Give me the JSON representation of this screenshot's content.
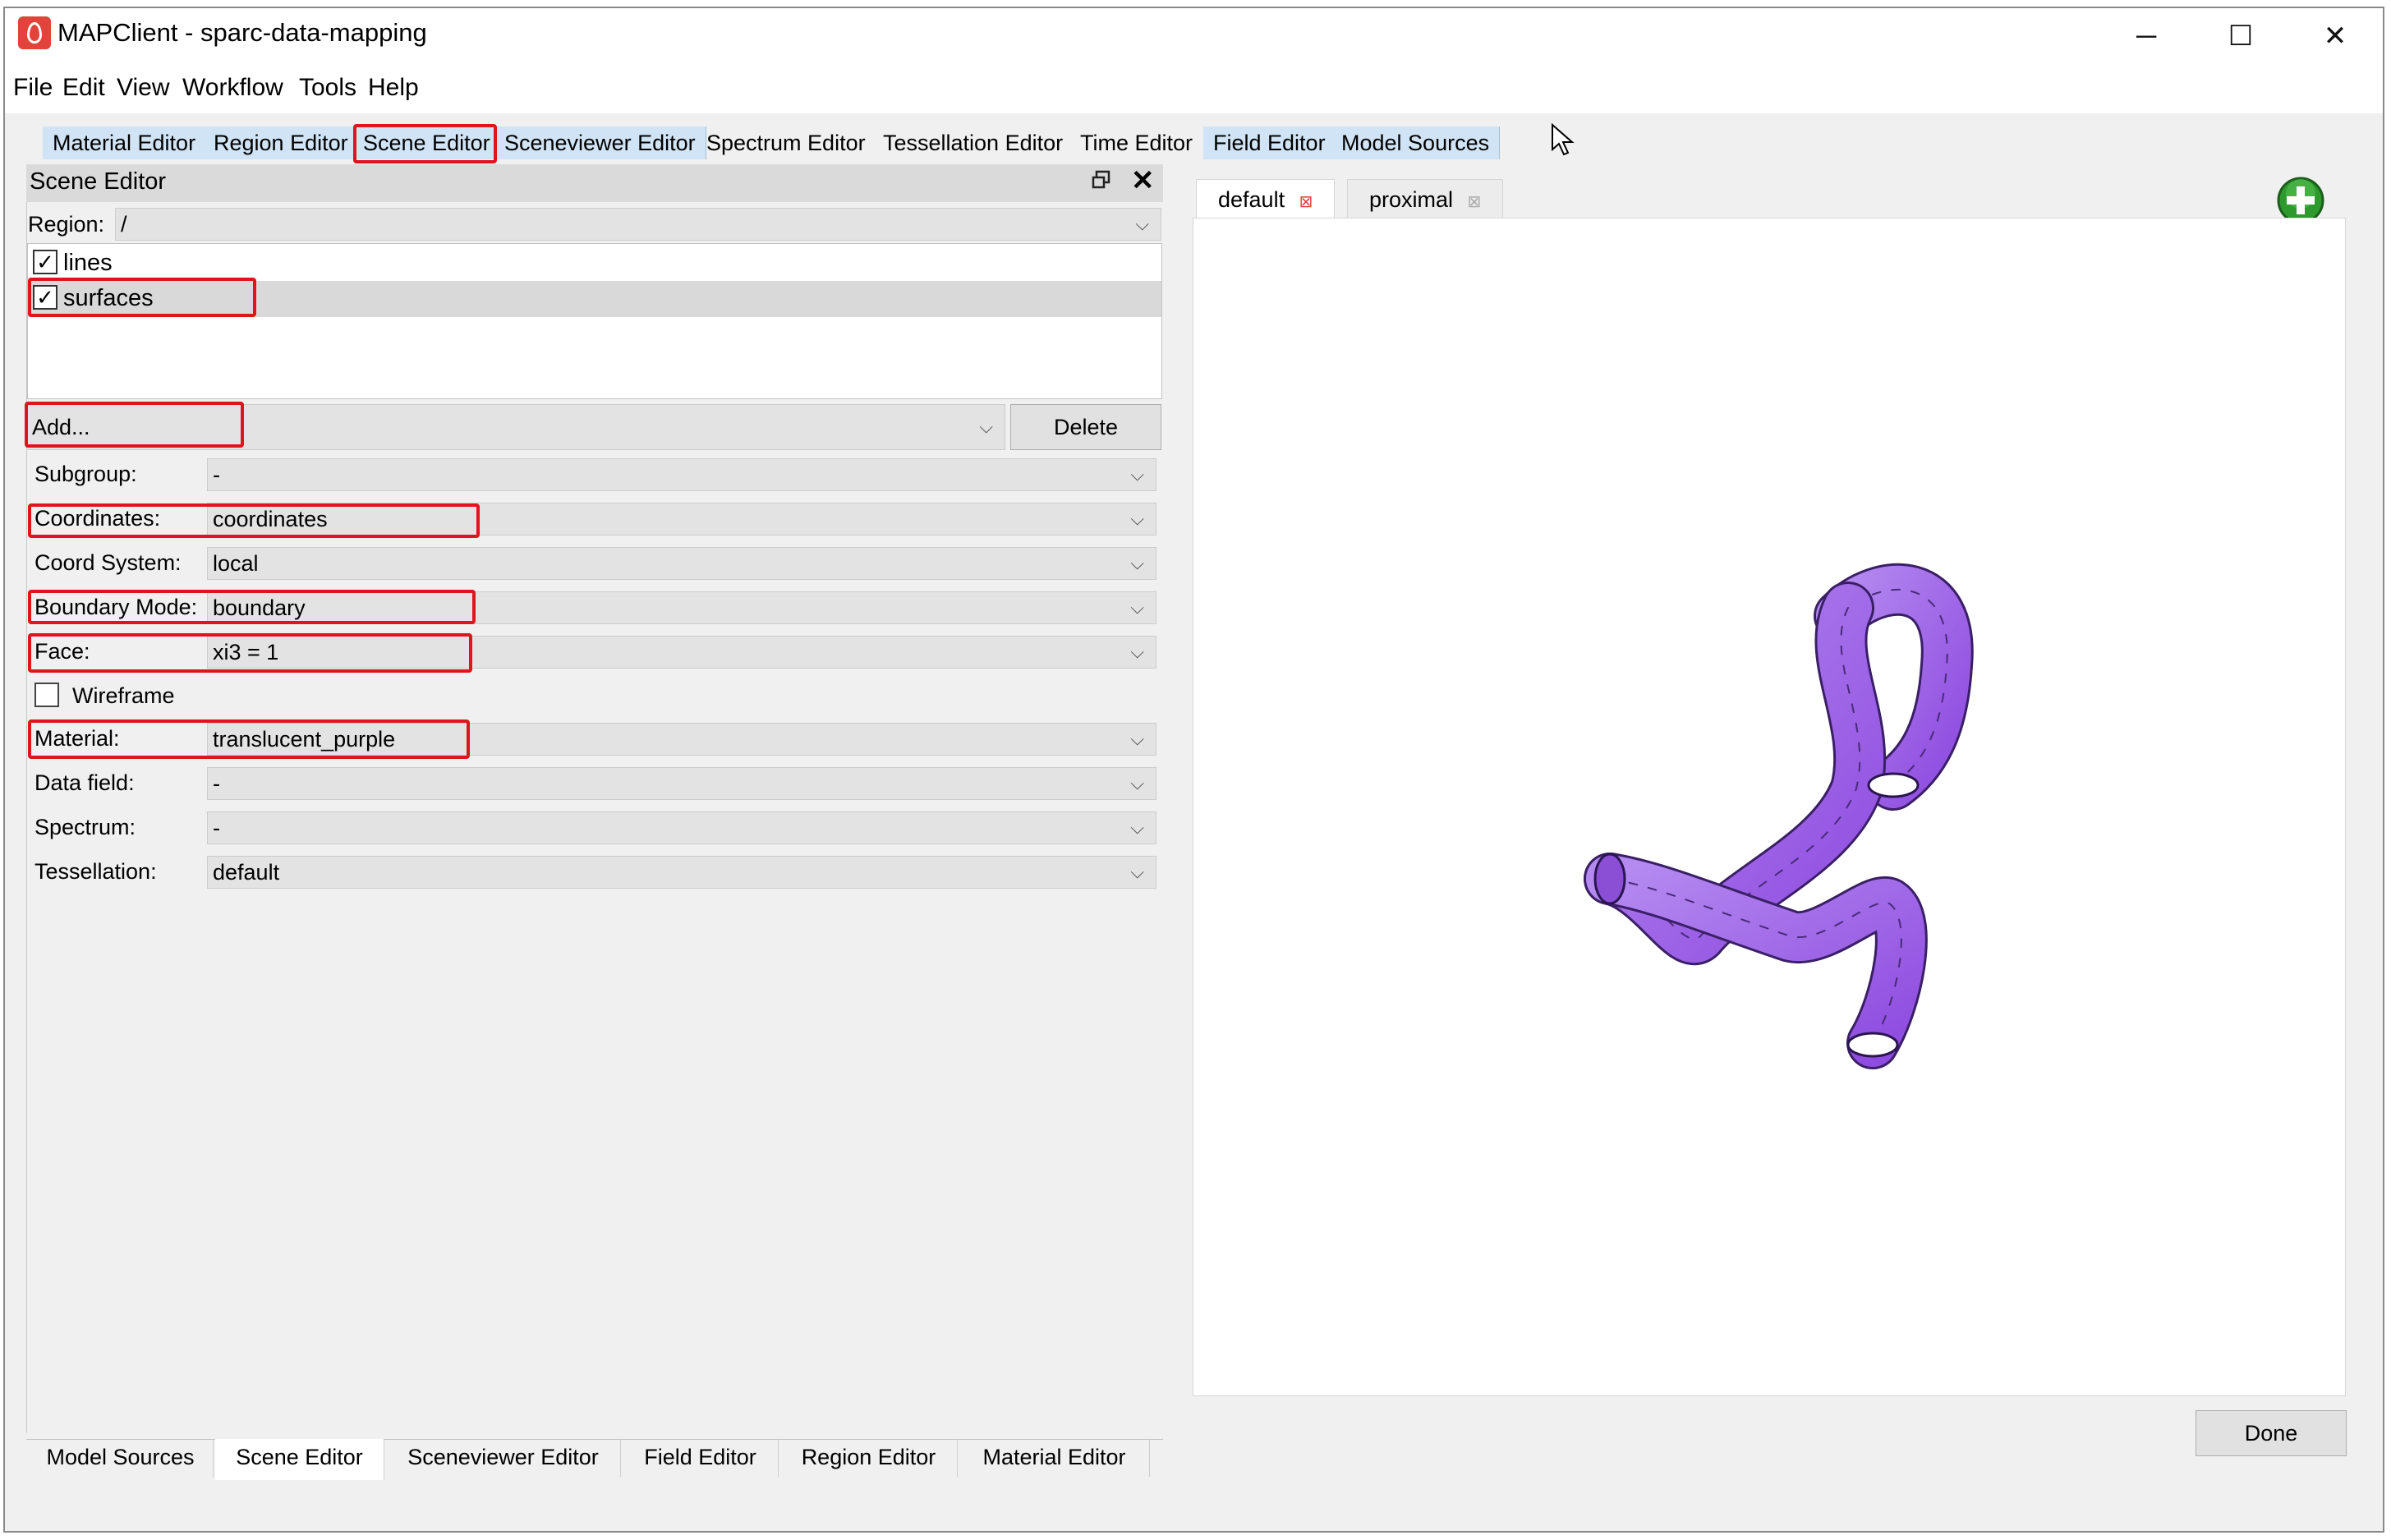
{
  "window": {
    "title": "MAPClient - sparc-data-mapping",
    "controls": [
      "─",
      "☐",
      "✕"
    ]
  },
  "menubar": [
    "File",
    "Edit",
    "View",
    "Workflow",
    "Tools",
    "Help"
  ],
  "top_tabs": [
    {
      "label": "Material Editor",
      "active": true
    },
    {
      "label": "Region Editor",
      "active": true
    },
    {
      "label": "Scene Editor",
      "active": true,
      "highlighted": true
    },
    {
      "label": "Sceneviewer Editor",
      "active": true
    },
    {
      "label": "Spectrum Editor",
      "active": false
    },
    {
      "label": "Tessellation Editor",
      "active": false
    },
    {
      "label": "Time Editor",
      "active": false
    },
    {
      "label": "Field Editor",
      "active": true
    },
    {
      "label": "Model Sources",
      "active": true
    }
  ],
  "scene_editor": {
    "title": "Scene Editor",
    "region_label": "Region:",
    "region_value": "/",
    "graphics": [
      {
        "label": "lines",
        "checked": true
      },
      {
        "label": "surfaces",
        "checked": true,
        "selected": true
      }
    ],
    "add_value": "Add...",
    "delete_label": "Delete",
    "fields": [
      {
        "label": "Subgroup:",
        "value": "-"
      },
      {
        "label": "Coordinates:",
        "value": "coordinates"
      },
      {
        "label": "Coord System:",
        "value": "local"
      },
      {
        "label": "Boundary Mode:",
        "value": "boundary"
      },
      {
        "label": "Face:",
        "value": "xi3 = 1"
      }
    ],
    "wireframe_label": "Wireframe",
    "wireframe_checked": false,
    "fields2": [
      {
        "label": "Material:",
        "value": "translucent_purple"
      },
      {
        "label": "Data field:",
        "value": "-"
      },
      {
        "label": "Spectrum:",
        "value": "-"
      },
      {
        "label": "Tessellation:",
        "value": "default"
      }
    ]
  },
  "bottom_tabs": [
    "Model Sources",
    "Scene Editor",
    "Sceneviewer Editor",
    "Field Editor",
    "Region Editor",
    "Material Editor"
  ],
  "bottom_tab_active": "Scene Editor",
  "viewer_tabs": [
    {
      "label": "default",
      "active": true
    },
    {
      "label": "proximal",
      "active": false
    }
  ],
  "done_label": "Done",
  "colors": {
    "highlight_box": "#e0141e",
    "active_tab": "#d0e4f5",
    "mesh": "#8f4ce0",
    "add_button": "#2e9a2e"
  }
}
